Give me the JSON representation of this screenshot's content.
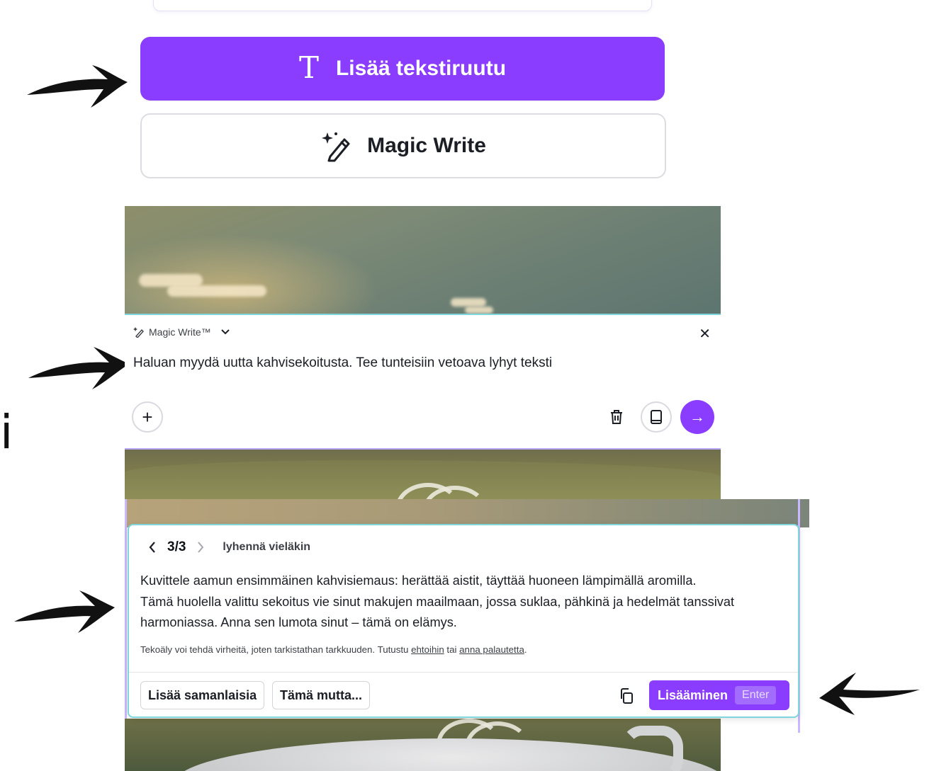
{
  "top_button": {
    "label": "Lisää tekstiruutu",
    "icon": "text-t-icon"
  },
  "magic_button": {
    "label": "Magic Write",
    "icon": "magic-pen-icon"
  },
  "prompt_panel": {
    "header_label": "Magic Write™",
    "prompt_text": "Haluan myydä uutta kahvisekoitusta. Tee tunteisiin vetoava lyhyt teksti",
    "send_icon": "→",
    "add_icon": "+",
    "close_icon": "✕"
  },
  "result": {
    "page_indicator": "3/3",
    "variant_label": "lyhennä vieläkin",
    "text_line1": "Kuvittele aamun ensimmäinen kahvisiemaus: herättää aistit, täyttää huoneen lämpimällä aromilla.",
    "text_line2": "Tämä huolella valittu sekoitus vie sinut makujen maailmaan, jossa suklaa, pähkinä ja hedelmät tanssivat",
    "text_line3": "harmoniassa. Anna sen lumota sinut – tämä on elämys.",
    "disclaimer_prefix": "Tekoäly voi tehdä virheitä, joten tarkistathan tarkkuuden. Tutustu ",
    "disclaimer_link1": "ehtoihin",
    "disclaimer_mid": " tai ",
    "disclaimer_link2": "anna palautetta",
    "disclaimer_suffix": ".",
    "more_like_this": "Lisää samanlaisia",
    "this_but": "Tämä mutta...",
    "insert_label": "Lisääminen",
    "insert_shortcut": "Enter"
  },
  "partial_letter": "i",
  "colors": {
    "accent": "#8b3dff",
    "accent_border": "#7fd6dd"
  }
}
